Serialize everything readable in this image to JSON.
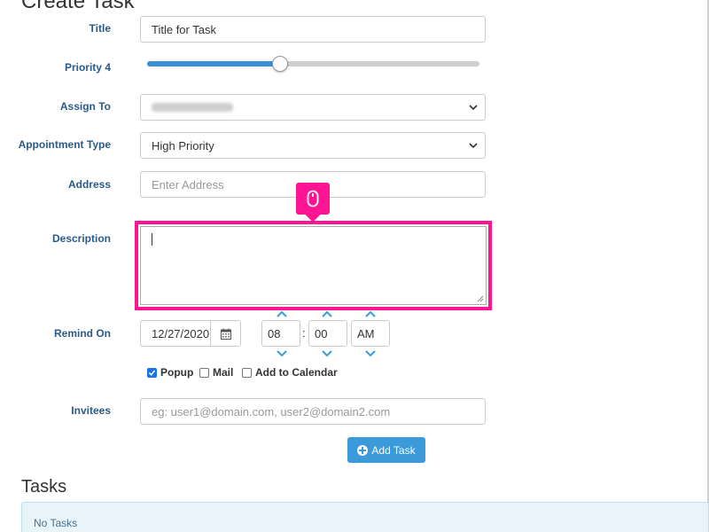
{
  "page": {
    "title": "Create Task"
  },
  "form": {
    "title_label": "Title",
    "title_value": "Title for Task",
    "priority_label": "Priority 4",
    "priority_level": 0.4,
    "assign_label": "Assign To",
    "assign_value": "",
    "appointment_label": "Appointment Type",
    "appointment_value": "High Priority",
    "address_label": "Address",
    "address_placeholder": "Enter Address",
    "description_label": "Description",
    "description_value": "",
    "remind_label": "Remind On",
    "remind_date": "12/27/2020",
    "remind_hour": "08",
    "remind_minute": "00",
    "remind_ampm": "AM",
    "time_separator": ":",
    "options": {
      "popup": "Popup",
      "popup_checked": true,
      "mail": "Mail",
      "mail_checked": false,
      "calendar": "Add to Calendar",
      "calendar_checked": false
    },
    "invitees_label": "Invitees",
    "invitees_placeholder": "eg: user1@domain.com, user2@domain2.com",
    "add_button": "Add Task"
  },
  "tasks": {
    "heading": "Tasks",
    "empty_text": "No Tasks"
  },
  "icons": {
    "calendar": "calendar-icon",
    "chevron": "chevron-down-icon",
    "mouse": "mouse-icon",
    "plus": "plus-circle-icon"
  },
  "colors": {
    "label": "#2a5a8a",
    "accent": "#3b9ad9",
    "highlight": "#ff1493"
  }
}
